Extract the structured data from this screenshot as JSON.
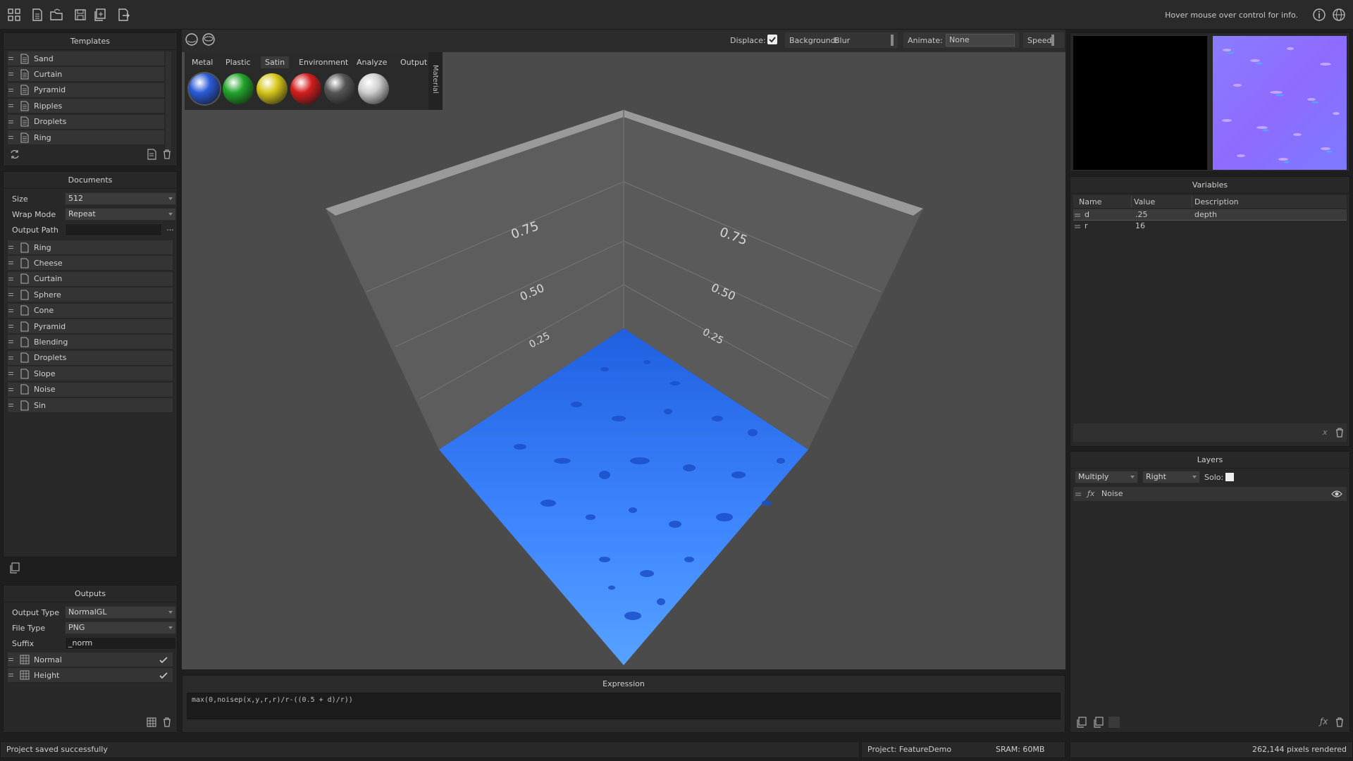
{
  "toolbar": {
    "hover_info": "Hover mouse over control for info.",
    "icons": [
      "grid-icon",
      "new-document-icon",
      "open-folder-icon",
      "save-icon",
      "save-copy-icon",
      "export-icon"
    ],
    "right_icons": [
      "info-icon",
      "globe-icon"
    ]
  },
  "templates": {
    "title": "Templates",
    "items": [
      "Sand",
      "Curtain",
      "Pyramid",
      "Ripples",
      "Droplets",
      "Ring"
    ]
  },
  "documents": {
    "title": "Documents",
    "size_label": "Size",
    "size_value": "512",
    "wrap_label": "Wrap Mode",
    "wrap_value": "Repeat",
    "output_path_label": "Output Path",
    "output_path_value": "",
    "browse_label": "...",
    "items": [
      "Ring",
      "Cheese",
      "Curtain",
      "Sphere",
      "Cone",
      "Pyramid",
      "Blending",
      "Droplets",
      "Slope",
      "Noise",
      "Sin"
    ]
  },
  "outputs": {
    "title": "Outputs",
    "type_label": "Output Type",
    "type_value": "NormalGL",
    "file_label": "File Type",
    "file_value": "PNG",
    "suffix_label": "Suffix",
    "suffix_value": "_norm",
    "items": [
      {
        "name": "Normal",
        "checked": true
      },
      {
        "name": "Height",
        "checked": true
      }
    ]
  },
  "viewport_bar": {
    "displace_label": "Displace:",
    "displace_checked": true,
    "background_label": "Background:",
    "background_value": "Blur",
    "animate_label": "Animate:",
    "animate_value": "None",
    "speed_label": "Speed:"
  },
  "material": {
    "tabs": [
      "Metal",
      "Plastic",
      "Satin",
      "Environment",
      "Analyze",
      "Output"
    ],
    "active_tab": "Satin",
    "side_label": "Material",
    "swatches": [
      "#2a5bd8",
      "#22a52a",
      "#d6c61a",
      "#d41e1e",
      "#555555",
      "#cfcfcf"
    ]
  },
  "viewport": {
    "left_ticks": [
      "0.75",
      "0.50",
      "0.25"
    ],
    "right_ticks": [
      "0.75",
      "0.50",
      "0.25"
    ]
  },
  "expression": {
    "title": "Expression",
    "value": "max(0,noisep(x,y,r,r)/r-((0.5 + d)/r))"
  },
  "variables": {
    "title": "Variables",
    "columns": [
      "Name",
      "Value",
      "Description"
    ],
    "rows": [
      {
        "name": "d",
        "value": ".25",
        "description": "depth"
      },
      {
        "name": "r",
        "value": "16",
        "description": ""
      }
    ]
  },
  "layers": {
    "title": "Layers",
    "blend_value": "Multiply",
    "side_value": "Right",
    "solo_label": "Solo:",
    "items": [
      {
        "name": "Noise"
      }
    ]
  },
  "status": {
    "message": "Project saved successfully",
    "project": "Project: FeatureDemo",
    "sram": "SRAM: 60MB",
    "pixels": "262,144 pixels rendered"
  },
  "colors": {
    "accent_blue": "#3f87ff",
    "panel": "#282828",
    "viewport": "#4b4b4b"
  }
}
